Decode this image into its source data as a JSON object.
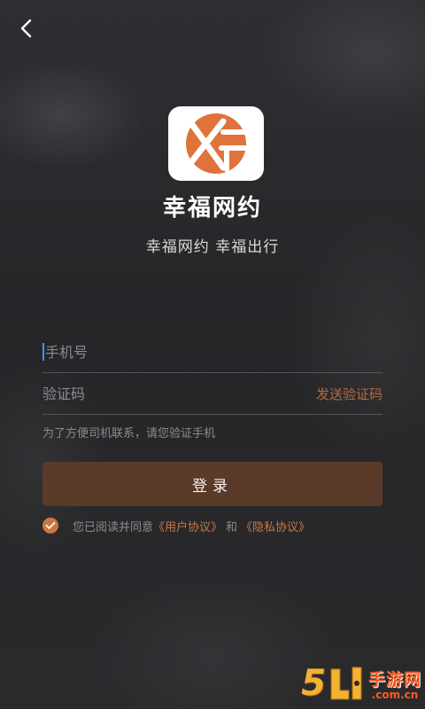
{
  "app": {
    "name": "幸福网约",
    "slogan": "幸福网约 幸福出行"
  },
  "form": {
    "phone_placeholder": "手机号",
    "phone_value": "",
    "code_placeholder": "验证码",
    "code_value": "",
    "send_code_label": "发送验证码",
    "hint": "为了方便司机联系，请您验证手机",
    "login_label": "登录"
  },
  "agreement": {
    "checked": true,
    "prefix": "您已阅读并同意",
    "user_link": "《用户协议》",
    "conj": "和",
    "privacy_link": "《隐私协议》"
  },
  "watermark": {
    "number": "5",
    "main": "手游网",
    "sub": ".com.cn"
  },
  "icons": {
    "back": "back-arrow-icon",
    "logo": "app-logo-icon",
    "check": "checkmark-icon"
  },
  "colors": {
    "accent": "#c97744",
    "button": "#5a3a28",
    "link": "#b46a3c",
    "logo_orange": "#e0733a"
  }
}
